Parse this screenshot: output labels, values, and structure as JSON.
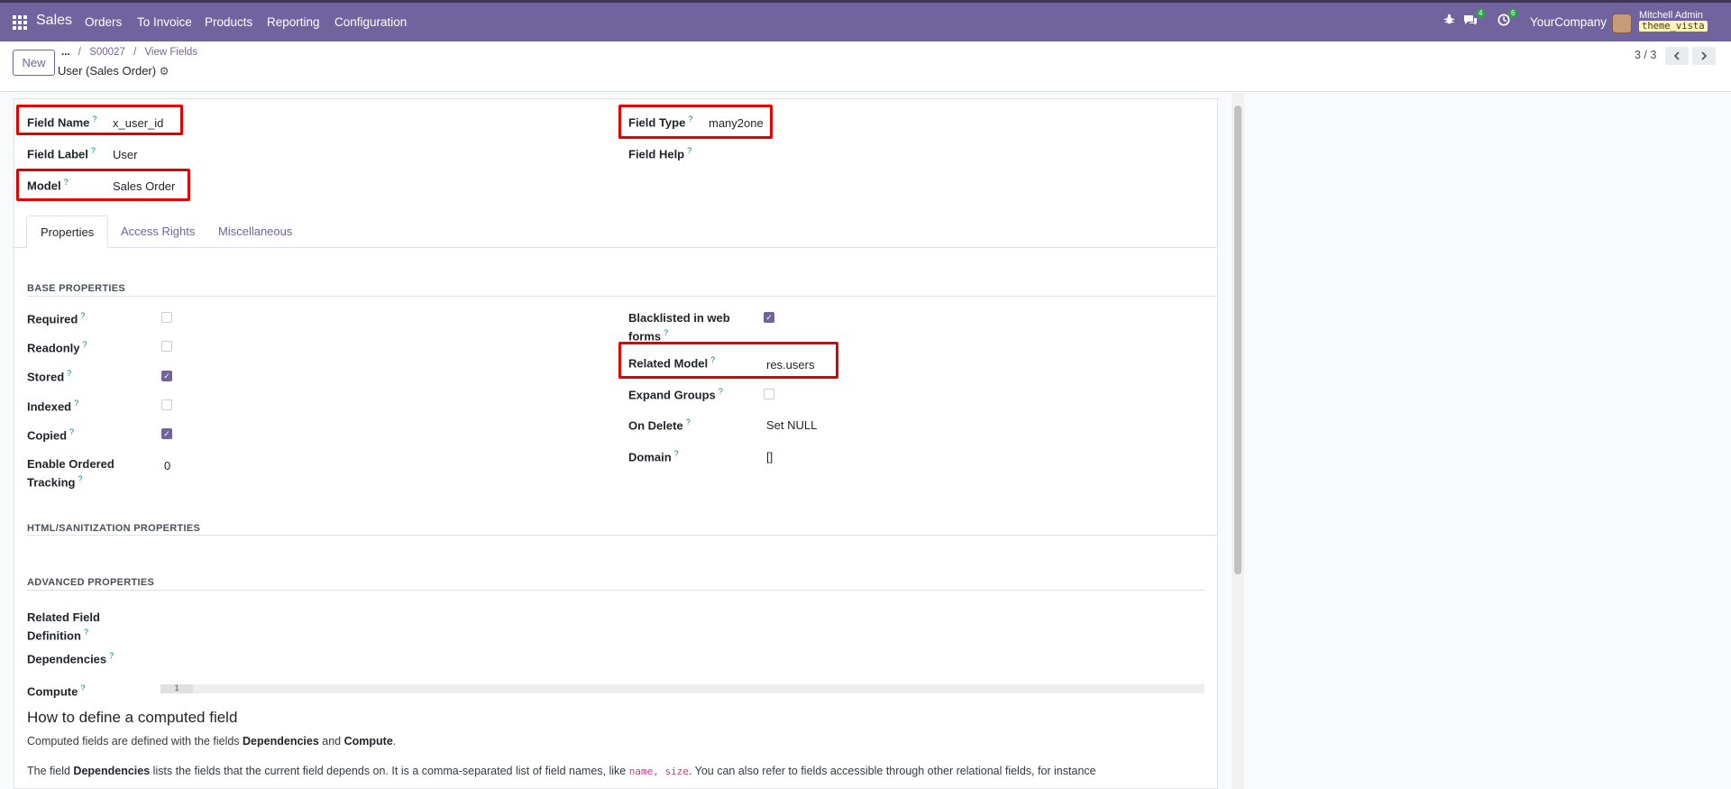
{
  "nav": {
    "app_name": "Sales",
    "menu": [
      "Orders",
      "To Invoice",
      "Products",
      "Reporting",
      "Configuration"
    ],
    "messages_badge": "4",
    "activities_badge": "6",
    "company": "YourCompany",
    "user_name": "Mitchell Admin",
    "db_name": "theme_vista"
  },
  "control": {
    "new_label": "New",
    "breadcrumb": [
      "...",
      "S00027",
      "View Fields"
    ],
    "record_title": "User (Sales Order)",
    "pager": "3 / 3"
  },
  "header_fields": {
    "field_name_label": "Field Name",
    "field_name_value": "x_user_id",
    "field_label_label": "Field Label",
    "field_label_value": "User",
    "model_label": "Model",
    "model_value": "Sales Order",
    "field_type_label": "Field Type",
    "field_type_value": "many2one",
    "field_help_label": "Field Help"
  },
  "tabs": [
    "Properties",
    "Access Rights",
    "Miscellaneous"
  ],
  "base": {
    "title": "BASE PROPERTIES",
    "required": "Required",
    "readonly": "Readonly",
    "stored": "Stored",
    "indexed": "Indexed",
    "copied": "Copied",
    "tracking_label_1": "Enable Ordered",
    "tracking_label_2": "Tracking",
    "tracking_value": "0",
    "blacklist_label_1": "Blacklisted in web",
    "blacklist_label_2": "forms",
    "related_model_label": "Related Model",
    "related_model_value": "res.users",
    "expand_groups": "Expand Groups",
    "on_delete_label": "On Delete",
    "on_delete_value": "Set NULL",
    "domain_label": "Domain",
    "domain_value": "[]"
  },
  "checkbox_states": {
    "required": false,
    "readonly": false,
    "stored": true,
    "indexed": false,
    "copied": true,
    "blacklisted": true,
    "expand_groups": false
  },
  "html_section": "HTML/SANITIZATION PROPERTIES",
  "advanced": {
    "title": "ADVANCED PROPERTIES",
    "related_def_1": "Related Field",
    "related_def_2": "Definition",
    "dependencies": "Dependencies",
    "compute": "Compute",
    "line_number": "1"
  },
  "help": {
    "heading": "How to define a computed field",
    "p1_a": "Computed fields are defined with the fields ",
    "p1_b": "Dependencies",
    "p1_c": " and ",
    "p1_d": "Compute",
    "p1_e": ".",
    "p2_a": "The field ",
    "p2_b": "Dependencies",
    "p2_c": " lists the fields that the current field depends on. It is a comma-separated list of field names, like ",
    "p2_code": "name, size",
    "p2_d": ". You can also refer to fields accessible through other relational fields, for instance"
  }
}
